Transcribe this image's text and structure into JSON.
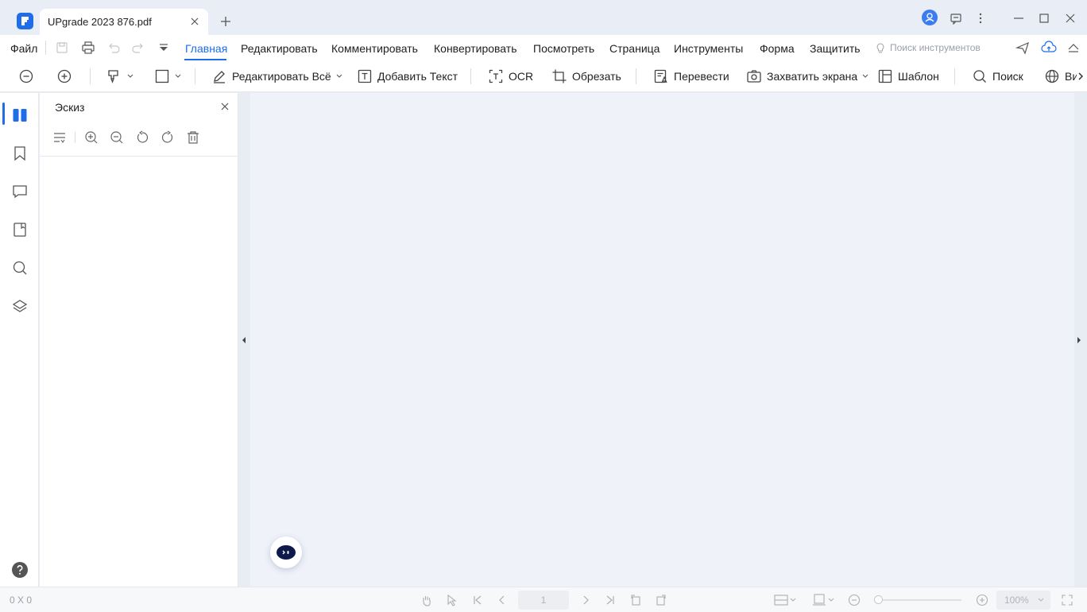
{
  "titlebar": {
    "tab_title": "UPgrade 2023 876.pdf"
  },
  "menu": {
    "file": "Файл",
    "items": [
      "Главная",
      "Редактировать",
      "Комментировать",
      "Конвертировать",
      "Посмотреть",
      "Страница",
      "Инструменты",
      "Форма",
      "Защитить"
    ],
    "active": "Главная",
    "tool_search_placeholder": "Поиск инструментов"
  },
  "toolbar": {
    "edit_all": "Редактировать Всё",
    "add_text": "Добавить Текст",
    "ocr": "OCR",
    "crop": "Обрезать",
    "translate": "Перевести",
    "screenshot": "Захватить экрана",
    "template": "Шаблон",
    "search": "Поиск",
    "view_partial": "Ви"
  },
  "thumbnail_panel": {
    "title": "Эскиз"
  },
  "statusbar": {
    "coordinates": "0 X 0",
    "page_number": "1",
    "zoom": "100%"
  },
  "colors": {
    "accent": "#1f6ee8",
    "viewer_bg": "#eff2f8",
    "titlebar_bg": "#e9eef6"
  }
}
